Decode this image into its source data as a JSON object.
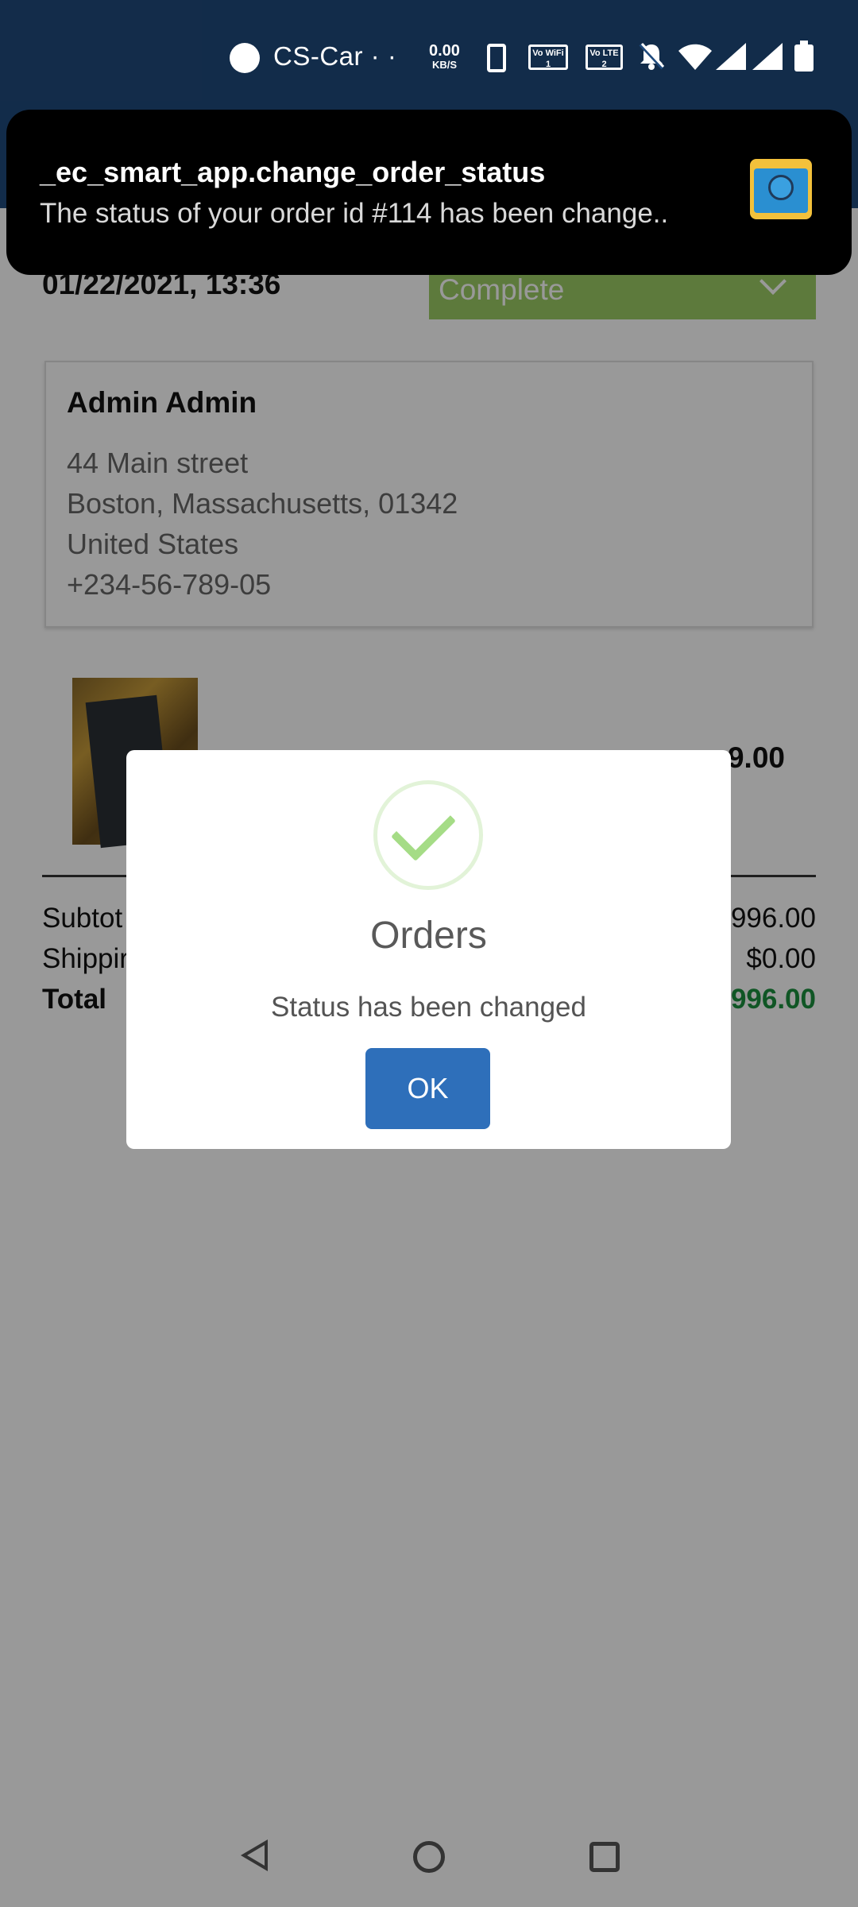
{
  "status_bar": {
    "carrier": "CS-Car · ·",
    "speed_value": "0.00",
    "speed_unit": "KB/S",
    "wifi_calling_label": "Vo WiFi 1",
    "lte_label": "Vo LTE 2"
  },
  "notification": {
    "title": "_ec_smart_app.change_order_status",
    "text": "The status of your order id #114 has been change.."
  },
  "order": {
    "date": "01/22/2021, 13:36",
    "status": "Complete"
  },
  "address": {
    "name": "Admin Admin",
    "street": "44 Main street",
    "city_line": "Boston, Massachusetts, 01342",
    "country": "United States",
    "phone": "+234-56-789-05"
  },
  "product": {
    "price_visible": "9.00"
  },
  "summary": {
    "subtotal_label": "Subtot",
    "subtotal_value": "996.00",
    "shipping_label": "Shippir",
    "shipping_value": "$0.00",
    "total_label": "Total",
    "total_value": "996.00"
  },
  "dialog": {
    "title": "Orders",
    "message": "Status has been changed",
    "ok_label": "OK"
  },
  "colors": {
    "header": "#1f4a7c",
    "status_select": "#9ccc65",
    "ok_button": "#2e6fba",
    "total_value": "#1b8f3f",
    "check": "#a5dc86"
  }
}
